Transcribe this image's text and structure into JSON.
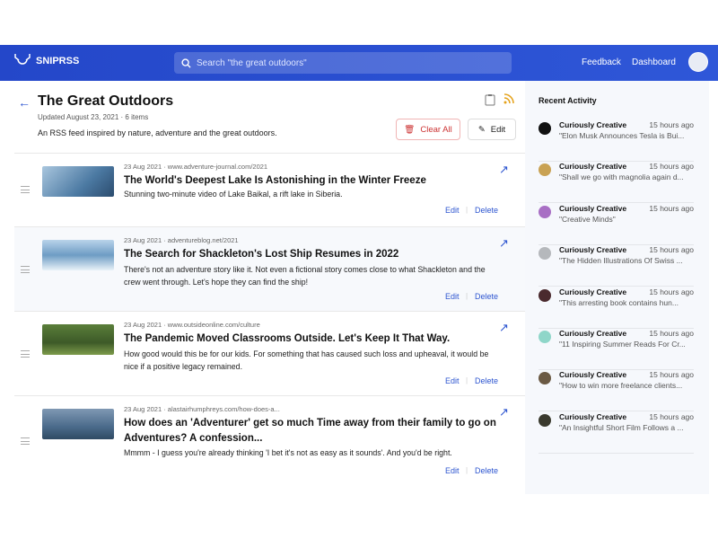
{
  "header": {
    "logo": "SNIPRSS",
    "search_placeholder": "Search \"the great outdoors\"",
    "feedback": "Feedback",
    "dashboard": "Dashboard"
  },
  "feed": {
    "title": "The Great Outdoors",
    "updated": "Updated August 23, 2021 · 6 items",
    "description": "An RSS feed inspired by nature, adventure and the great outdoors.",
    "clear_all": "Clear All",
    "edit": "Edit"
  },
  "items": [
    {
      "meta": "23 Aug 2021 · www.adventure-journal.com/2021",
      "title": "The World's Deepest Lake Is Astonishing in the Winter Freeze",
      "summary": "Stunning two-minute video of Lake Baikal, a rift lake in Siberia.",
      "edit": "Edit",
      "delete": "Delete"
    },
    {
      "meta": "23 Aug 2021 · adventureblog.net/2021",
      "title": "The Search for Shackleton's Lost Ship Resumes in 2022",
      "summary": "There's not an adventure story like it. Not even a fictional story comes close to what Shackleton and the crew went through. Let's hope they can find the ship!",
      "edit": "Edit",
      "delete": "Delete"
    },
    {
      "meta": "23 Aug 2021 · www.outsideonline.com/culture",
      "title": "The Pandemic Moved Classrooms Outside. Let's Keep It That Way.",
      "summary": "How good would this be for our kids. For something that has caused such loss and upheaval, it would be nice if a positive legacy remained.",
      "edit": "Edit",
      "delete": "Delete"
    },
    {
      "meta": "23 Aug 2021 · alastairhumphreys.com/how-does-a...",
      "title": "How does an 'Adventurer' get so much Time away from their family to go on Adventures? A confession...",
      "summary": "Mmmm - I guess you're already thinking 'I bet it's not as easy as it sounds'. And you'd be right.",
      "edit": "Edit",
      "delete": "Delete"
    }
  ],
  "sidebar": {
    "title": "Recent Activity",
    "activity": [
      {
        "name": "Curiously Creative",
        "time": "15 hours ago",
        "quote": "\"Elon Musk Announces Tesla is Bui...",
        "color": "#111111"
      },
      {
        "name": "Curiously Creative",
        "time": "15 hours ago",
        "quote": "\"Shall we go with magnolia again d...",
        "color": "#c9a253"
      },
      {
        "name": "Curiously Creative",
        "time": "15 hours ago",
        "quote": "\"Creative Minds\"",
        "color": "#a86fc4"
      },
      {
        "name": "Curiously Creative",
        "time": "15 hours ago",
        "quote": "\"The Hidden Illustrations Of Swiss ...",
        "color": "#b5b8bc"
      },
      {
        "name": "Curiously Creative",
        "time": "15 hours ago",
        "quote": "\"This arresting book contains hun...",
        "color": "#4a2a2e"
      },
      {
        "name": "Curiously Creative",
        "time": "15 hours ago",
        "quote": "\"11 Inspiring Summer Reads For Cr...",
        "color": "#8fd6c9"
      },
      {
        "name": "Curiously Creative",
        "time": "15 hours ago",
        "quote": "\"How to win more freelance clients...",
        "color": "#6b5a44"
      },
      {
        "name": "Curiously Creative",
        "time": "15 hours ago",
        "quote": "\"An Insightful Short Film Follows a ...",
        "color": "#3a3a2e"
      }
    ]
  }
}
